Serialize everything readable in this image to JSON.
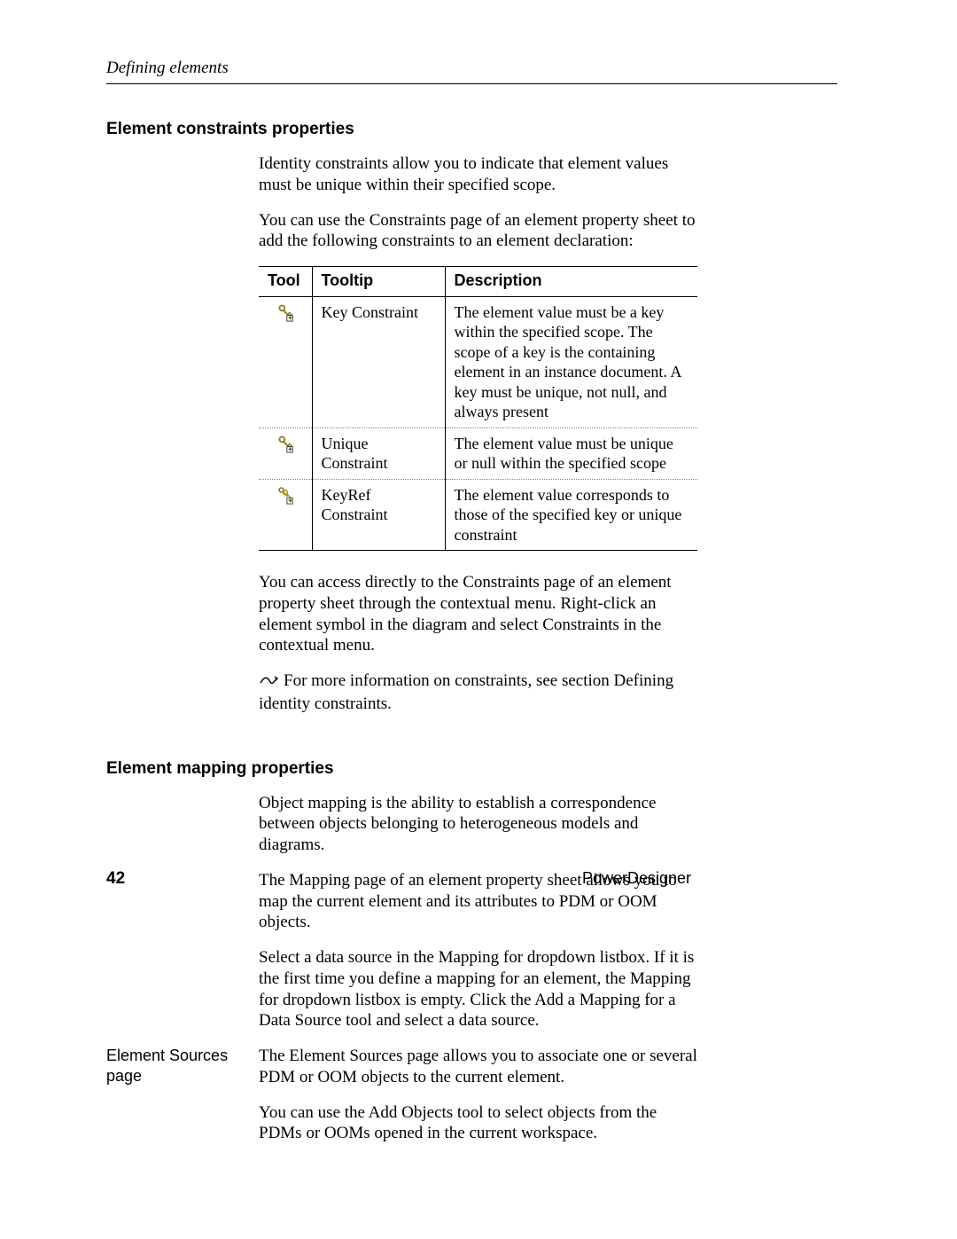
{
  "header": {
    "running_head": "Defining elements"
  },
  "section1": {
    "heading": "Element constraints properties",
    "p1": "Identity constraints allow you to indicate that element values must be unique within their specified scope.",
    "p2": "You can use the Constraints page of an element property sheet to add the following constraints to an element declaration:",
    "table": {
      "headers": {
        "tool": "Tool",
        "tooltip": "Tooltip",
        "description": "Description"
      },
      "rows": [
        {
          "tooltip": "Key Constraint",
          "description": "The element value must be a key within the specified scope. The scope of a key is the containing element in an instance document. A key must be unique, not null, and always present"
        },
        {
          "tooltip": "Unique Constraint",
          "description": "The element value must be unique or null within the specified scope"
        },
        {
          "tooltip": "KeyRef Constraint",
          "description": "The element value corresponds to those of the specified key or unique constraint"
        }
      ]
    },
    "p3": "You can access directly to the Constraints page of an element property sheet through the contextual menu. Right-click an element symbol in the diagram and select Constraints in the contextual menu.",
    "note": "For more information on constraints, see section Defining identity constraints."
  },
  "section2": {
    "heading": "Element mapping properties",
    "p1": "Object mapping is the ability to establish a correspondence between objects belonging to heterogeneous models and diagrams.",
    "p2": "The Mapping page of an element property sheet allows you to map the current element and its attributes to PDM or OOM objects.",
    "p3": "Select a data source in the Mapping for dropdown listbox. If it is the first time you define a mapping for an element, the Mapping for dropdown listbox is empty. Click the Add a Mapping for a Data Source tool and select a data source.",
    "side_label": "Element Sources page",
    "p4": "The Element Sources page allows you to associate one or several PDM or OOM objects to the current element.",
    "p5": "You can use the Add Objects tool to select objects from the PDMs or OOMs opened in the current workspace."
  },
  "footer": {
    "page_number": "42",
    "product": "PowerDesigner"
  }
}
